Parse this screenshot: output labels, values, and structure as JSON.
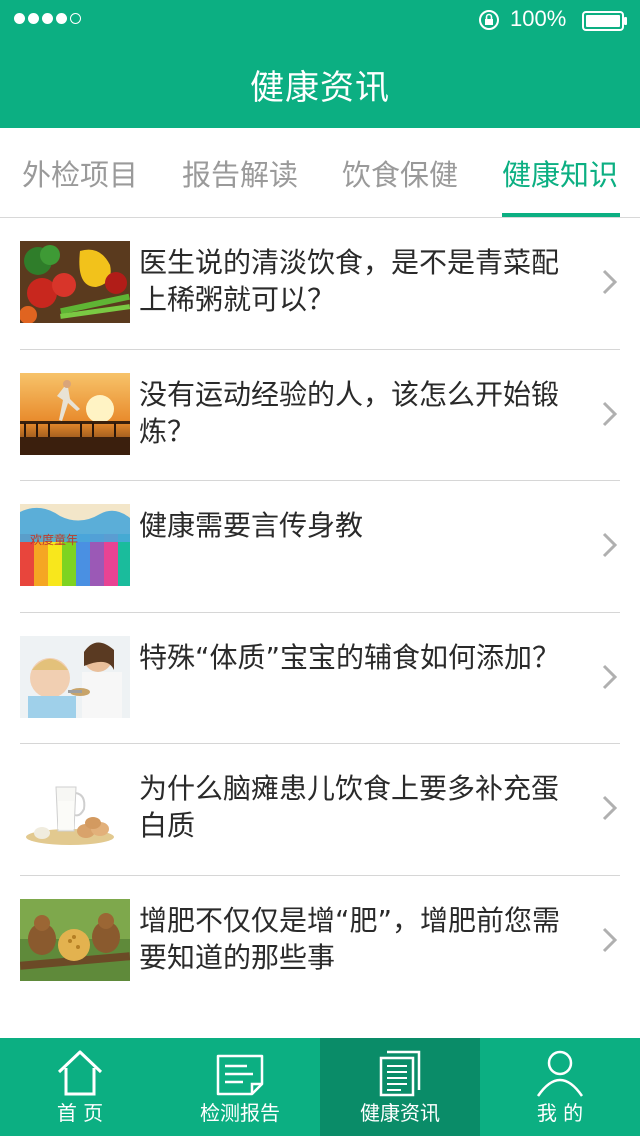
{
  "status_bar": {
    "battery_text": "100%",
    "signal_dots_filled": 4,
    "signal_dots_total": 5
  },
  "header": {
    "title": "健康资讯"
  },
  "tabs": [
    {
      "label": "外检项目",
      "active": false
    },
    {
      "label": "报告解读",
      "active": false
    },
    {
      "label": "饮食保健",
      "active": false
    },
    {
      "label": "健康知识",
      "active": true
    }
  ],
  "articles": [
    {
      "title": "医生说的清淡饮食，是不是青菜配上稀粥就可以？",
      "thumb": "vegetables"
    },
    {
      "title": "没有运动经验的人，该怎么开始锻炼？",
      "thumb": "runner-sunset"
    },
    {
      "title": "健康需要言传身教",
      "thumb": "colorful-fence",
      "thumb_text": "欢度童年"
    },
    {
      "title": "特殊“体质”宝宝的辅食如何添加？",
      "thumb": "mother-feeding-baby"
    },
    {
      "title": "为什么脑瘫患儿饮食上要多补充蛋白质",
      "thumb": "milk-and-eggs"
    },
    {
      "title": "增肥不仅仅是增“肥”，增肥前您需要知道的那些事",
      "thumb": "squirrels-cookie"
    }
  ],
  "bottom_nav": [
    {
      "label": "首 页",
      "icon": "home-icon",
      "active": false
    },
    {
      "label": "检测报告",
      "icon": "report-icon",
      "active": false
    },
    {
      "label": "健康资讯",
      "icon": "news-icon",
      "active": true
    },
    {
      "label": "我 的",
      "icon": "user-icon",
      "active": false
    }
  ],
  "colors": {
    "brand": "#0caf82",
    "brand_dark": "#0a8c68",
    "tab_inactive": "#9a9a9a",
    "divider": "#d6d6d6"
  }
}
